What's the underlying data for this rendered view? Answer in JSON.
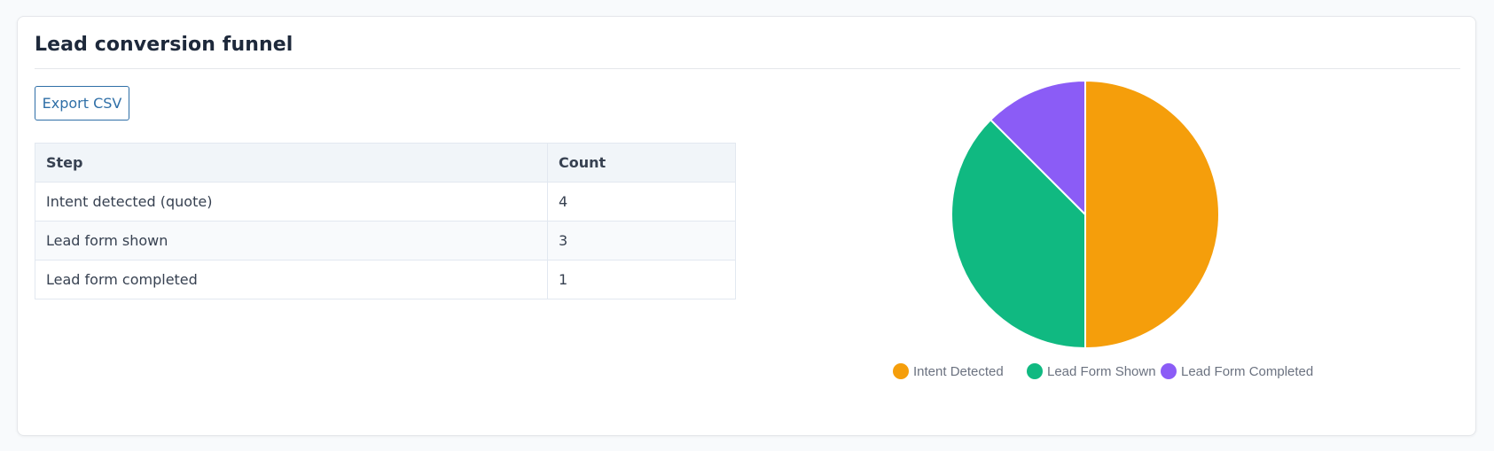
{
  "panel": {
    "title": "Lead conversion funnel",
    "export_label": "Export CSV"
  },
  "table": {
    "headers": [
      "Step",
      "Count"
    ],
    "rows": [
      {
        "step": "Intent detected (quote)",
        "count": "4"
      },
      {
        "step": "Lead form shown",
        "count": "3"
      },
      {
        "step": "Lead form completed",
        "count": "1"
      }
    ]
  },
  "chart_data": {
    "type": "pie",
    "categories": [
      "Intent Detected",
      "Lead Form Shown",
      "Lead Form Completed"
    ],
    "values": [
      4,
      3,
      1
    ],
    "colors": [
      "#f59e0b",
      "#10b981",
      "#8b5cf6"
    ],
    "legend_position": "bottom"
  }
}
